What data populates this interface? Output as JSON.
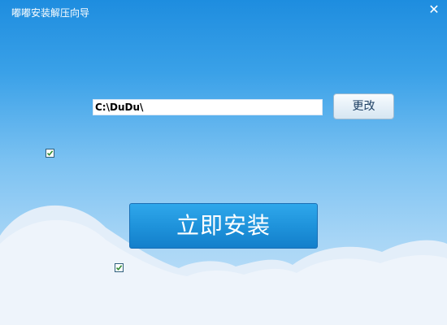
{
  "window": {
    "title": "嘟嘟安装解压向导",
    "close_symbol": "✕"
  },
  "install_path": {
    "value": "C:\\DuDu\\"
  },
  "change_button": {
    "label": "更改"
  },
  "install_button": {
    "label": "立即安装"
  },
  "checkboxes": [
    {
      "checked": true
    },
    {
      "checked": true
    }
  ],
  "colors": {
    "sky_top": "#1e8ddf",
    "sky_bottom": "#c6e3f9",
    "install_button": "#1f93db",
    "cloud": "#eef4fb"
  },
  "icons": {
    "close": "close-icon",
    "check": "checkmark-icon"
  }
}
